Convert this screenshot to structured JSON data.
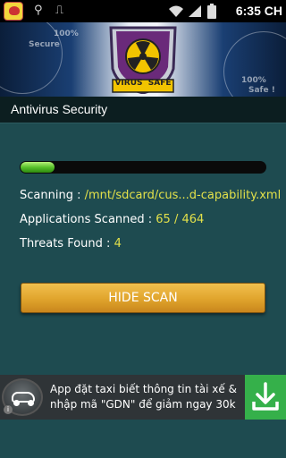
{
  "status_bar": {
    "time": "6:35 CH",
    "icons": [
      "app-notification-icon",
      "usb-icon",
      "android-debug-icon",
      "wifi-icon",
      "signal-icon",
      "battery-icon"
    ]
  },
  "banner": {
    "shield_text": "VIRUS  SAFE",
    "bg_labels": [
      "100%",
      "Secure",
      "100%",
      "Safe !"
    ]
  },
  "header": {
    "title": "Antivirus Security"
  },
  "scan": {
    "progress": 0.14,
    "scanning_label": "Scanning : ",
    "scanning_value": "/mnt/sdcard/cus...d-capability.xml",
    "apps_label": "Applications Scanned : ",
    "apps_value": "65 / 464",
    "threats_label": "Threats Found : ",
    "threats_value": "4",
    "hide_button": "HIDE SCAN"
  },
  "ad": {
    "text": "App đặt taxi biết thông tin tài xế & nhập mã \"GDN\" để giảm ngay 30k"
  },
  "colors": {
    "background": "#1e4b50",
    "value_yellow": "#e2e04a",
    "button_orange": "#e0a42c",
    "progress_green": "#58c12b",
    "ad_download_green": "#35b04a"
  }
}
